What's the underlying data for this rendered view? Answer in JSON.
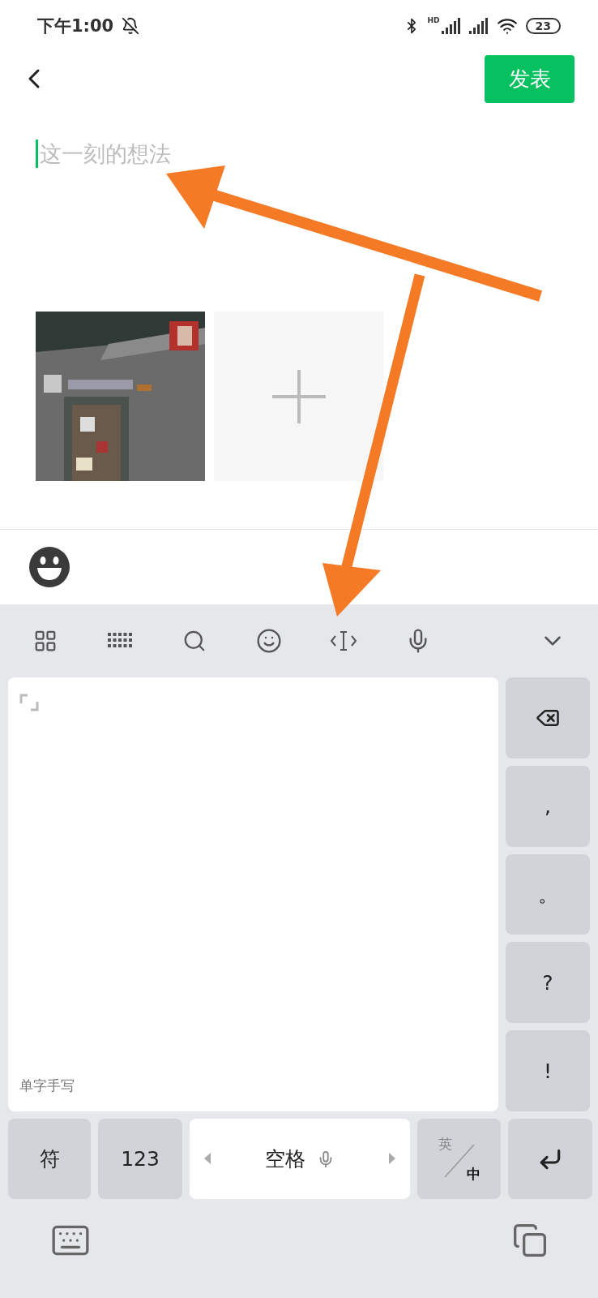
{
  "status_bar": {
    "time": "下午1:00",
    "network_label": "HD",
    "battery": "23"
  },
  "header": {
    "publish_button": "发表"
  },
  "composer": {
    "placeholder": "这一刻的想法"
  },
  "photos": [
    {
      "kind": "picture"
    },
    {
      "kind": "add"
    }
  ],
  "keyboard": {
    "pad_label": "单字手写",
    "side_keys": [
      {
        "kind": "backspace"
      },
      {
        "kind": "char",
        "label": ","
      },
      {
        "kind": "char",
        "label": "。"
      },
      {
        "kind": "char",
        "label": "?"
      },
      {
        "kind": "char",
        "label": "!"
      }
    ],
    "bottom_keys": [
      {
        "kind": "text",
        "label": "符"
      },
      {
        "kind": "text",
        "label": "123"
      },
      {
        "kind": "space",
        "label": "空格"
      },
      {
        "kind": "lang",
        "label": "英",
        "sub_label": "中"
      },
      {
        "kind": "enter"
      }
    ]
  }
}
